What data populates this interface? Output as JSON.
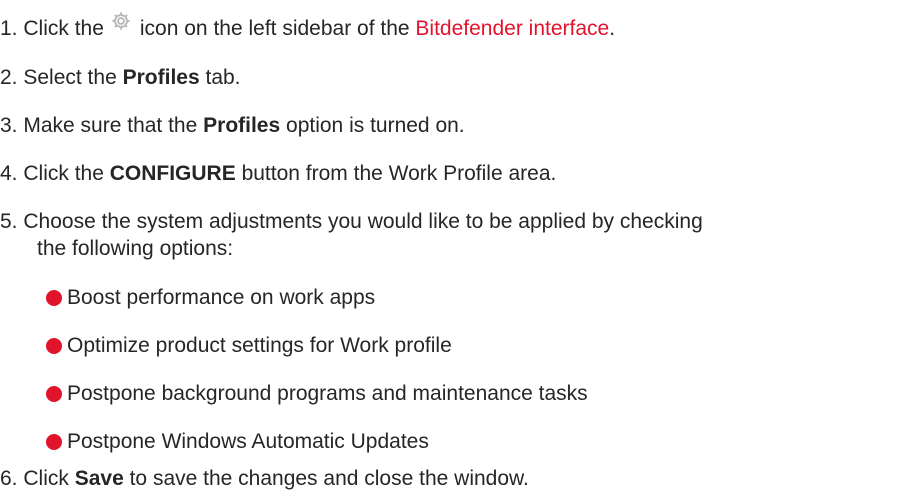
{
  "steps": [
    {
      "num": "1.",
      "pre": "Click the",
      "icon": "gear-icon",
      "mid": "icon on the left sidebar of the",
      "link": "Bitdefender interface",
      "post": "."
    },
    {
      "num": "2.",
      "pre": "Select the",
      "bold": "Profiles",
      "post": "tab."
    },
    {
      "num": "3.",
      "pre": "Make sure that the",
      "bold": "Profiles",
      "post": "option is turned on."
    },
    {
      "num": "4.",
      "pre": "Click the",
      "bold": "CONFIGURE",
      "post": "button from the Work Profile area."
    },
    {
      "num": "5.",
      "line1": "Choose the system adjustments you would like to be applied by checking",
      "line2": "the following options:",
      "options": [
        "Boost performance on work apps",
        "Optimize product settings for Work profile",
        "Postpone background programs and maintenance tasks",
        "Postpone Windows Automatic Updates"
      ]
    },
    {
      "num": "6.",
      "pre": "Click",
      "bold": "Save",
      "post": "to save the changes and close the window."
    }
  ],
  "colors": {
    "accent": "#e2142d",
    "text": "#262626",
    "icon": "#b8b8b8"
  }
}
